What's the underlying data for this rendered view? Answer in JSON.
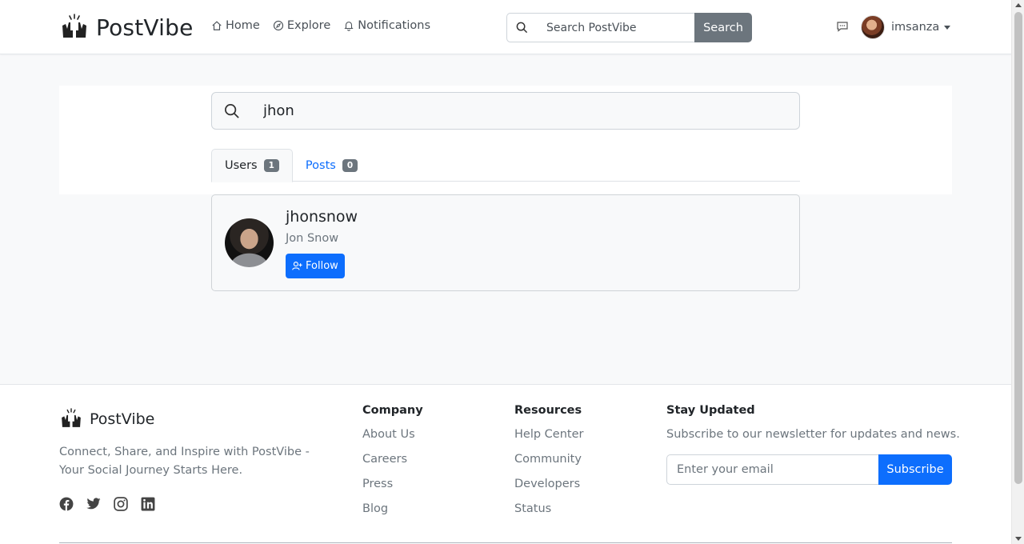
{
  "brand": {
    "name": "PostVibe",
    "logo_icon": "hands-up-icon"
  },
  "nav": {
    "items": [
      {
        "label": "Home",
        "icon": "home-icon"
      },
      {
        "label": "Explore",
        "icon": "compass-icon"
      },
      {
        "label": "Notifications",
        "icon": "bell-icon"
      }
    ]
  },
  "header_search": {
    "placeholder": "Search PostVibe",
    "button_label": "Search"
  },
  "user": {
    "username": "imsanza"
  },
  "search": {
    "query": "jhon"
  },
  "tabs": [
    {
      "label": "Users",
      "count": "1",
      "active": true
    },
    {
      "label": "Posts",
      "count": "0",
      "active": false
    }
  ],
  "results": [
    {
      "username": "jhonsnow",
      "full_name": "Jon Snow",
      "action_label": "Follow"
    }
  ],
  "footer": {
    "brand": "PostVibe",
    "tagline": "Connect, Share, and Inspire with PostVibe - Your Social Journey Starts Here.",
    "social": [
      "facebook-icon",
      "twitter-icon",
      "instagram-icon",
      "linkedin-icon"
    ],
    "company": {
      "title": "Company",
      "links": [
        "About Us",
        "Careers",
        "Press",
        "Blog"
      ]
    },
    "resources": {
      "title": "Resources",
      "links": [
        "Help Center",
        "Community",
        "Developers",
        "Status"
      ]
    },
    "newsletter": {
      "title": "Stay Updated",
      "text": "Subscribe to our newsletter for updates and news.",
      "placeholder": "Enter your email",
      "button_label": "Subscribe"
    }
  },
  "colors": {
    "primary": "#0d6efd",
    "secondary": "#6c757d",
    "background": "#f8f9fa"
  }
}
